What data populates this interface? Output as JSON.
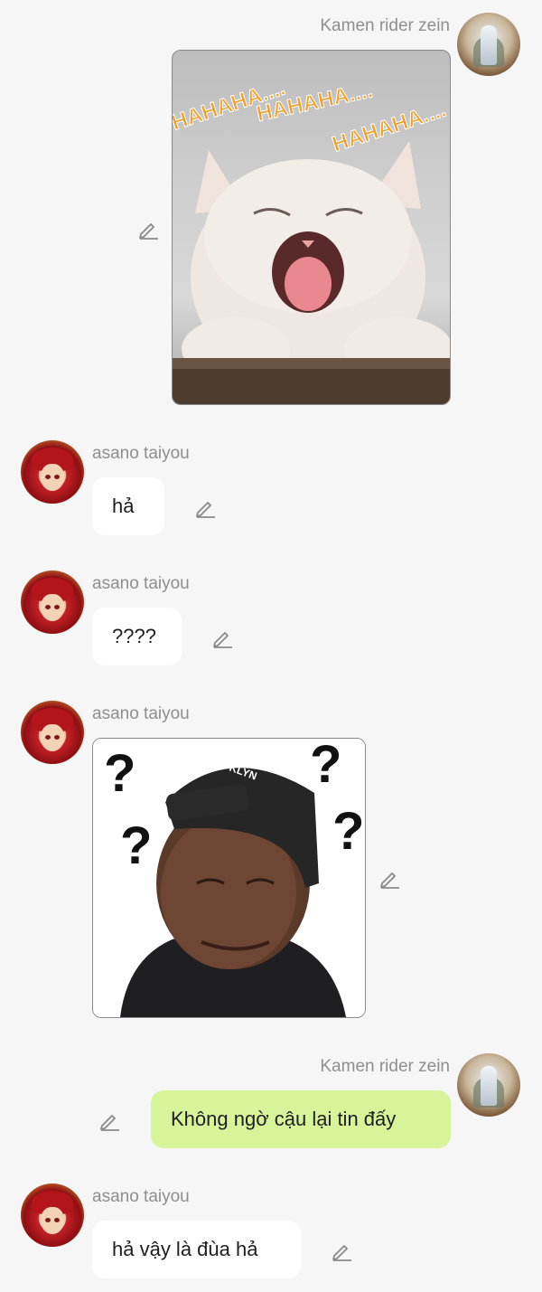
{
  "messages": [
    {
      "sender": "Kamen rider zein",
      "side": "right",
      "kind": "image",
      "image_text": [
        "HAHAHA....",
        "HAHAHA....",
        "HAHAHA...."
      ],
      "image_subject": "laughing white kitten"
    },
    {
      "sender": "asano taiyou",
      "side": "left",
      "kind": "text",
      "text": "hả"
    },
    {
      "sender": "asano taiyou",
      "side": "left",
      "kind": "text",
      "text": "????"
    },
    {
      "sender": "asano taiyou",
      "side": "left",
      "kind": "image",
      "image_text": [
        "?",
        "?",
        "?",
        "?"
      ],
      "cap_text": "KLYN",
      "image_subject": "confused man in black cap"
    },
    {
      "sender": "Kamen rider zein",
      "side": "right",
      "kind": "text",
      "text": "Không ngờ cậu lại tin đấy"
    },
    {
      "sender": "asano taiyou",
      "side": "left",
      "kind": "text",
      "text": "hả vậy là đùa hả"
    }
  ],
  "colors": {
    "background": "#f6f6f6",
    "incoming_bubble": "#ffffff",
    "outgoing_bubble": "#d7f49a",
    "name_text": "#8e8e8e",
    "message_text": "#1e1e1e",
    "haha_text": "#f0a02a"
  },
  "icons": {
    "edit": "pencil-edit-icon"
  }
}
